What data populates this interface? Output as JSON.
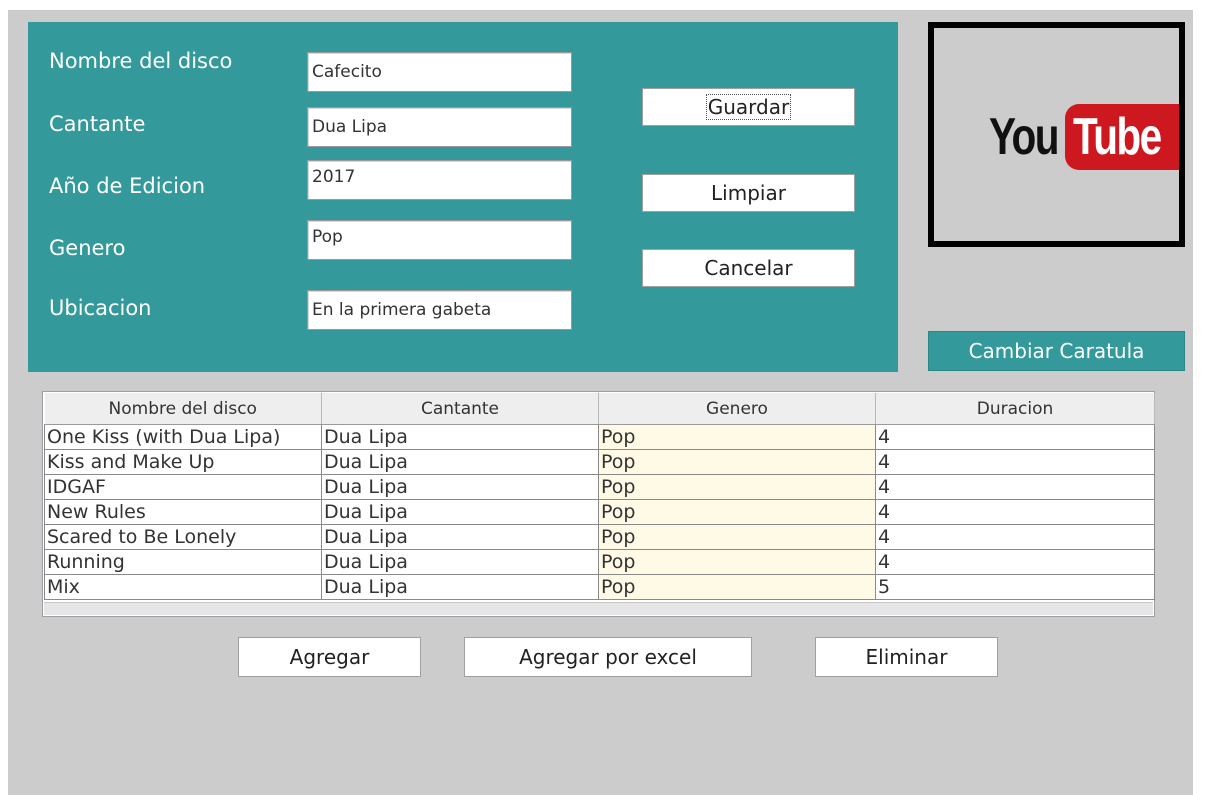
{
  "form": {
    "fields": [
      {
        "label": "Nombre del disco",
        "value": "Cafecito"
      },
      {
        "label": "Cantante",
        "value": "Dua Lipa"
      },
      {
        "label": "Año de Edicion",
        "value": "2017"
      },
      {
        "label": "Genero",
        "value": "Pop"
      },
      {
        "label": "Ubicacion",
        "value": "En la primera gabeta"
      }
    ],
    "buttons": {
      "save": "Guardar",
      "clear": "Limpiar",
      "cancel": "Cancelar"
    }
  },
  "cover": {
    "logo_text_left": "You",
    "logo_text_right": "Tube",
    "change_button": "Cambiar Caratula"
  },
  "table": {
    "columns": [
      "Nombre del disco",
      "Cantante",
      "Genero",
      "Duracion"
    ],
    "rows": [
      [
        "One Kiss (with Dua Lipa)",
        "Dua Lipa",
        "Pop",
        "4"
      ],
      [
        "Kiss and Make Up",
        "Dua Lipa",
        "Pop",
        "4"
      ],
      [
        "IDGAF",
        "Dua Lipa",
        "Pop",
        "4"
      ],
      [
        "New Rules",
        "Dua Lipa",
        "Pop",
        "4"
      ],
      [
        "Scared to Be Lonely",
        "Dua Lipa",
        "Pop",
        "4"
      ],
      [
        "Running",
        "Dua Lipa",
        "Pop",
        "4"
      ],
      [
        "Mix",
        "Dua Lipa",
        "Pop",
        "5"
      ]
    ]
  },
  "actions": {
    "add": "Agregar",
    "add_excel": "Agregar por excel",
    "delete": "Eliminar"
  },
  "colors": {
    "panel": "#33999a",
    "window_bg": "#cccccc",
    "youtube_red": "#cc181e"
  }
}
